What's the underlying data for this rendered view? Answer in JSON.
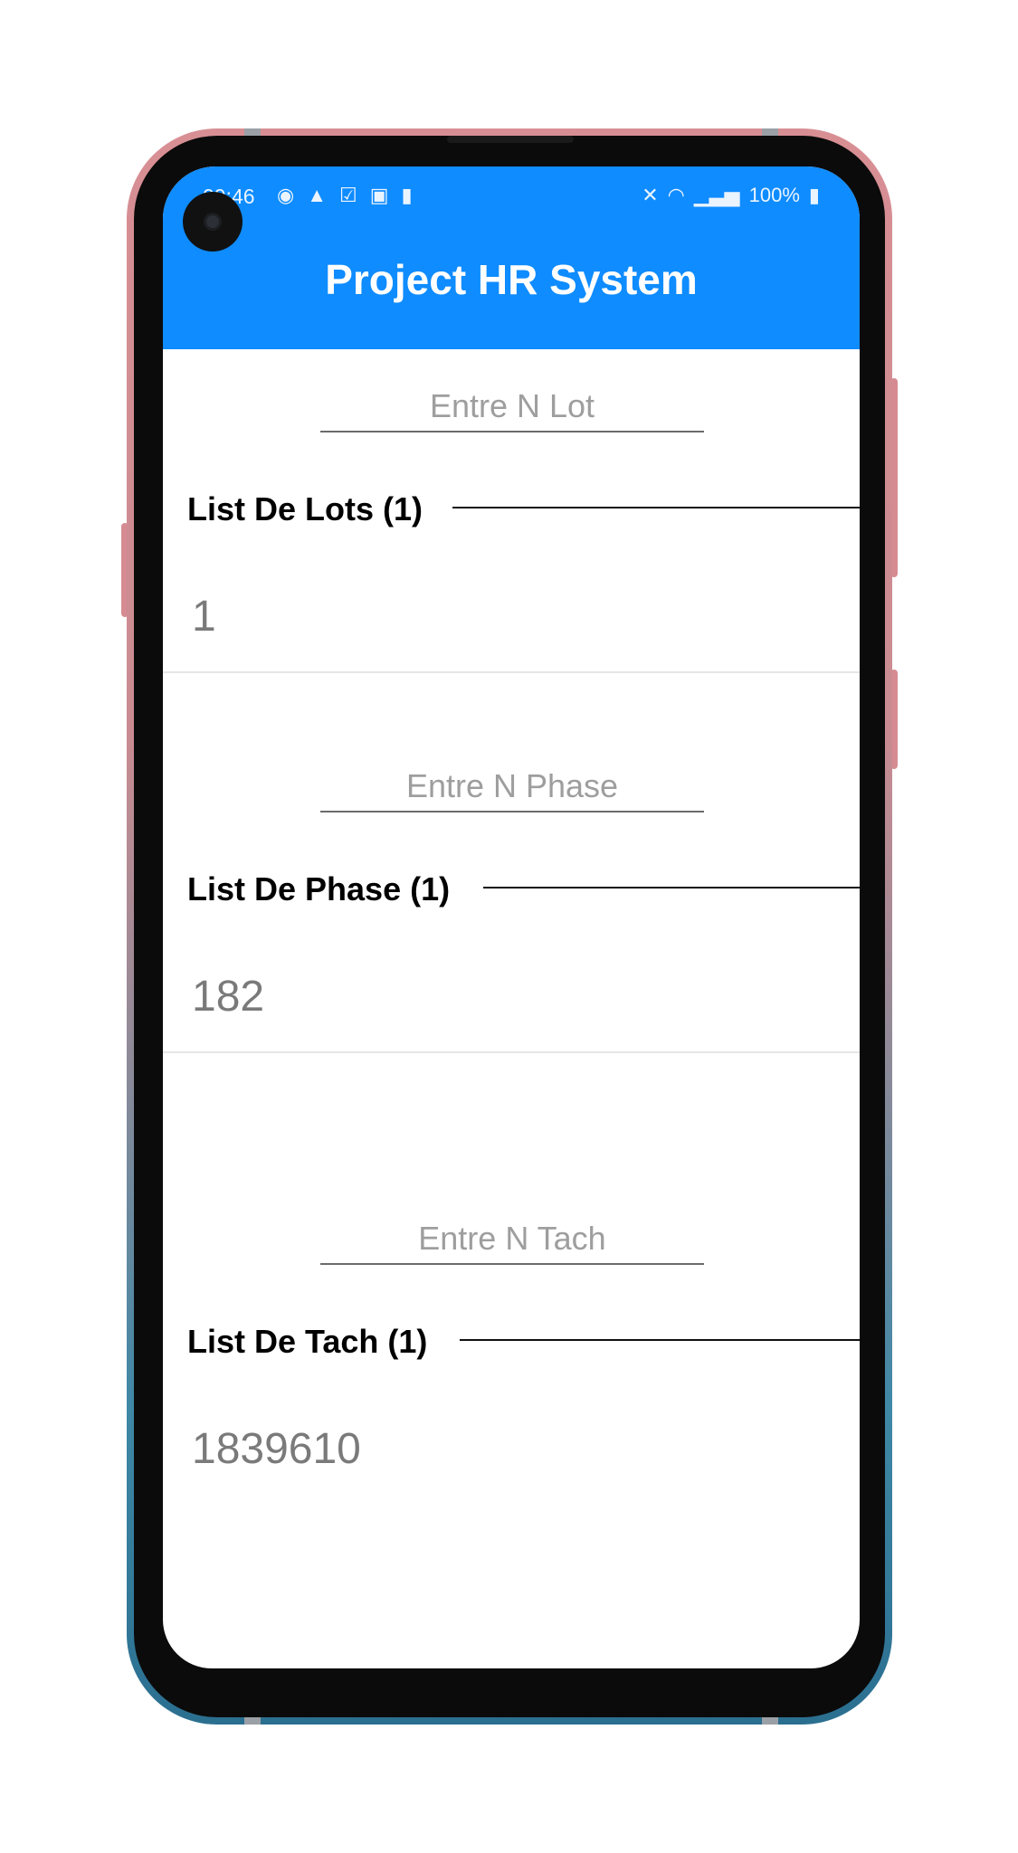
{
  "status_bar": {
    "time": "09:46",
    "battery": "100%",
    "left_icons": [
      "messenger-icon",
      "warning-icon",
      "check-icon",
      "image-icon",
      "battery-saver-icon"
    ],
    "right_icons": [
      "mute-icon",
      "wifi-icon",
      "signal-icon",
      "battery-icon"
    ]
  },
  "app": {
    "title": "Project HR System",
    "accent_color": "#0f8cff"
  },
  "sections": [
    {
      "placeholder": "Entre N Lot",
      "label": "List De Lots (1)",
      "value": "1"
    },
    {
      "placeholder": "Entre N Phase",
      "label": "List De Phase (1)",
      "value": "182"
    },
    {
      "placeholder": "Entre N Tach",
      "label": "List De Tach (1)",
      "value": "1839610"
    }
  ]
}
